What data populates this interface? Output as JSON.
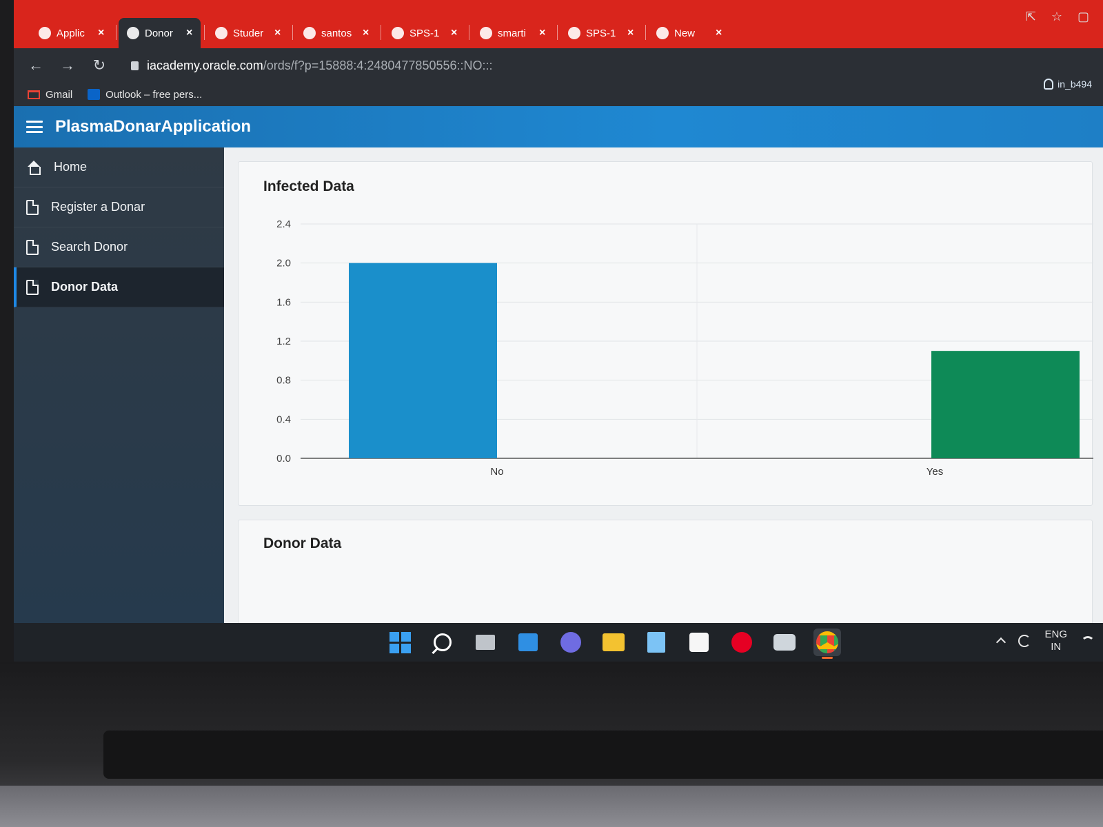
{
  "browser": {
    "tabs": [
      {
        "title": "Applic",
        "active": false
      },
      {
        "title": "Donor",
        "active": true
      },
      {
        "title": "Studer",
        "active": false
      },
      {
        "title": "santos",
        "active": false
      },
      {
        "title": "SPS-1",
        "active": false
      },
      {
        "title": "smarti",
        "active": false
      },
      {
        "title": "SPS-1",
        "active": false
      },
      {
        "title": "New",
        "active": false
      }
    ],
    "url_host": "iacademy.oracle.com",
    "url_path": "/ords/f?p=15888:4:2480477850556::NO:::",
    "bookmarks": [
      "Gmail",
      "Outlook – free pers..."
    ],
    "user": "in_b494"
  },
  "app": {
    "title": "PlasmaDonarApplication",
    "nav": [
      {
        "label": "Home",
        "icon": "home-icon",
        "active": false
      },
      {
        "label": "Register a Donar",
        "icon": "page-icon",
        "active": false
      },
      {
        "label": "Search Donor",
        "icon": "page-icon",
        "active": false
      },
      {
        "label": "Donor Data",
        "icon": "page-icon",
        "active": true
      }
    ],
    "regions": {
      "chart_title": "Infected Data",
      "report_title": "Donor Data"
    }
  },
  "taskbar": {
    "lang_top": "ENG",
    "lang_bottom": "IN"
  },
  "colors": {
    "bar_no": "#1a8fcb",
    "bar_yes": "#0e8a57",
    "header": "#1f88d2",
    "tabstrip": "#d9251c"
  },
  "chart_data": {
    "type": "bar",
    "categories": [
      "No",
      "Yes"
    ],
    "values": [
      2.0,
      1.1
    ],
    "ylim": [
      0,
      2.4
    ],
    "yticks": [
      0.0,
      0.4,
      0.8,
      1.2,
      1.6,
      2.0,
      2.4
    ],
    "grid": true,
    "colors": [
      "#1a8fcb",
      "#0e8a57"
    ]
  }
}
